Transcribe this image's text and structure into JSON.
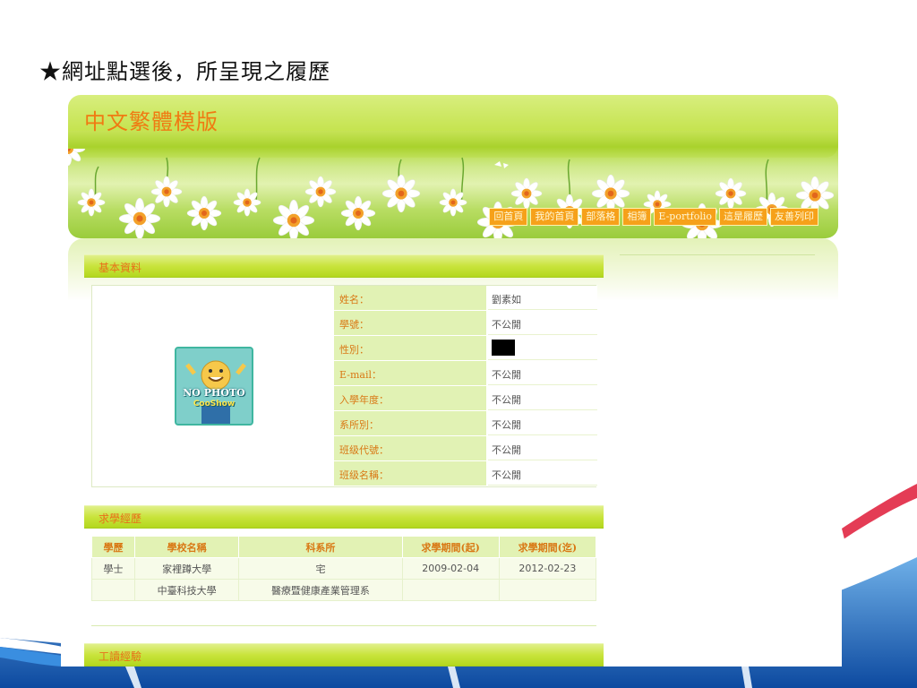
{
  "slide": {
    "title": "★網址點選後，所呈現之履歷"
  },
  "banner": {
    "title": "中文繁體模版",
    "nav": [
      "回首頁",
      "我的首頁",
      "部落格",
      "相簿",
      "E-portfolio",
      "這是履歷",
      "友善列印"
    ]
  },
  "basic_info": {
    "heading": "基本資料",
    "photo_text": "NO PHOTO",
    "photo_sub": "CooShow",
    "fields": [
      {
        "label": "姓名：",
        "value": "劉素如"
      },
      {
        "label": "學號：",
        "value": "不公開"
      },
      {
        "label": "性別：",
        "value": ""
      },
      {
        "label": "E-mail：",
        "value": "不公開"
      },
      {
        "label": "入學年度：",
        "value": "不公開"
      },
      {
        "label": "系所別：",
        "value": "不公開"
      },
      {
        "label": "班级代號：",
        "value": "不公開"
      },
      {
        "label": "班级名稱：",
        "value": "不公開"
      }
    ]
  },
  "education": {
    "heading": "求學經歷",
    "columns": [
      "學歷",
      "學校名稱",
      "科系所",
      "求學期間(起)",
      "求學期間(迄)"
    ],
    "rows": [
      [
        "學士",
        "家裡蹲大學",
        "宅",
        "2009-02-04",
        "2012-02-23"
      ],
      [
        "",
        "中臺科技大學",
        "醫療暨健康產業管理系",
        "",
        ""
      ]
    ]
  },
  "work": {
    "heading": "工讀經驗"
  },
  "colors": {
    "accent": "#f07a12",
    "green": "#b3d71e",
    "nav": "#f6a11a"
  }
}
